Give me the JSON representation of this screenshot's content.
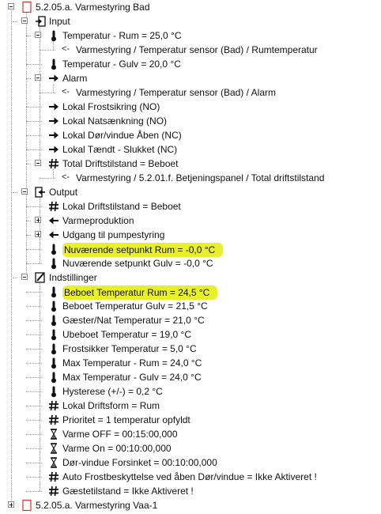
{
  "tree": {
    "rows": [
      {
        "depth": 0,
        "expander": "minus",
        "icon": "document-red-icon",
        "name": "root-node",
        "label": "5.2.05.a. Varmestyring Bad"
      },
      {
        "depth": 1,
        "expander": "minus",
        "icon": "input-icon",
        "name": "input-group",
        "label": "Input"
      },
      {
        "depth": 2,
        "expander": "minus",
        "icon": "thermometer-icon",
        "name": "temp-rum",
        "label": "Temperatur - Rum = 25,0 °C"
      },
      {
        "depth": 3,
        "expander": "none",
        "icon": "reference-arrow-icon",
        "name": "temp-rum-ref",
        "label": "Varmestyring / Temperatur sensor (Bad)  / Rumtemperatur"
      },
      {
        "depth": 2,
        "expander": "none",
        "icon": "thermometer-icon",
        "name": "temp-gulv",
        "label": "Temperatur - Gulv = 20,0 °C"
      },
      {
        "depth": 2,
        "expander": "minus",
        "icon": "arrow-right-icon",
        "name": "alarm",
        "label": "Alarm"
      },
      {
        "depth": 3,
        "expander": "none",
        "icon": "reference-arrow-icon",
        "name": "alarm-ref",
        "label": "Varmestyring / Temperatur sensor (Bad)  / Alarm"
      },
      {
        "depth": 2,
        "expander": "none",
        "icon": "arrow-right-icon",
        "name": "lokal-frostsikring",
        "label": "Lokal Frostsikring (NO)"
      },
      {
        "depth": 2,
        "expander": "none",
        "icon": "arrow-right-icon",
        "name": "lokal-natsaenkning",
        "label": "Lokal Natsænkning (NO)"
      },
      {
        "depth": 2,
        "expander": "none",
        "icon": "arrow-right-icon",
        "name": "lokal-dor-vindue",
        "label": "Lokal Dør/vindue Åben (NC)"
      },
      {
        "depth": 2,
        "expander": "none",
        "icon": "arrow-right-icon",
        "name": "lokal-taendt-slukket",
        "label": "Lokal Tændt - Slukket (NC)"
      },
      {
        "depth": 2,
        "expander": "minus",
        "icon": "hash-icon",
        "name": "total-driftstilstand",
        "label": "Total Driftstilstand = Beboet"
      },
      {
        "depth": 3,
        "expander": "none",
        "icon": "reference-arrow-icon",
        "name": "total-driftstilstand-ref",
        "label": "Varmestyring / 5.2.01.f. Betjeningspanel / Total driftstilstand"
      },
      {
        "depth": 1,
        "expander": "minus",
        "icon": "output-icon",
        "name": "output-group",
        "label": "Output"
      },
      {
        "depth": 2,
        "expander": "none",
        "icon": "hash-icon",
        "name": "lokal-driftstilstand",
        "label": "Lokal Driftstilstand = Beboet"
      },
      {
        "depth": 2,
        "expander": "plus",
        "icon": "arrow-left-icon",
        "name": "varmeproduktion",
        "label": "Varmeproduktion"
      },
      {
        "depth": 2,
        "expander": "plus",
        "icon": "arrow-left-icon",
        "name": "udgang-pumpestyring",
        "label": "Udgang til pumpestyring"
      },
      {
        "depth": 2,
        "expander": "none",
        "icon": "thermometer-icon",
        "name": "setpunkt-rum",
        "label": "Nuværende setpunkt Rum = -0,0 °C",
        "highlight": true
      },
      {
        "depth": 2,
        "expander": "none",
        "icon": "thermometer-icon",
        "name": "setpunkt-gulv",
        "label": "Nuværende setpunkt Gulv = -0,0 °C"
      },
      {
        "depth": 1,
        "expander": "minus",
        "icon": "edit-icon",
        "name": "indstillinger-group",
        "label": "Indstillinger"
      },
      {
        "depth": 2,
        "expander": "none",
        "icon": "thermometer-icon",
        "name": "beboet-temp-rum",
        "label": "Beboet Temperatur Rum = 24,5 °C",
        "highlight": true
      },
      {
        "depth": 2,
        "expander": "none",
        "icon": "thermometer-icon",
        "name": "beboet-temp-gulv",
        "label": "Beboet Temperatur Gulv = 21,5 °C"
      },
      {
        "depth": 2,
        "expander": "none",
        "icon": "thermometer-icon",
        "name": "gaester-nat-temp",
        "label": "Gæster/Nat Temperatur  = 21,0 °C"
      },
      {
        "depth": 2,
        "expander": "none",
        "icon": "thermometer-icon",
        "name": "ubeboet-temp",
        "label": "Ubeboet Temperatur  = 19,0 °C"
      },
      {
        "depth": 2,
        "expander": "none",
        "icon": "thermometer-icon",
        "name": "frostsikker-temp",
        "label": "Frostsikker Temperatur  = 5,0 °C"
      },
      {
        "depth": 2,
        "expander": "none",
        "icon": "thermometer-icon",
        "name": "max-temp-rum",
        "label": "Max Temperatur - Rum = 24,0 °C"
      },
      {
        "depth": 2,
        "expander": "none",
        "icon": "thermometer-icon",
        "name": "max-temp-gulv",
        "label": "Max Temperatur - Gulv = 24,0 °C"
      },
      {
        "depth": 2,
        "expander": "none",
        "icon": "thermometer-icon",
        "name": "hysterese",
        "label": "Hysterese (+/-) = 0,2 °C"
      },
      {
        "depth": 2,
        "expander": "none",
        "icon": "hash-icon",
        "name": "lokal-driftsform",
        "label": "Lokal Driftsform = Rum"
      },
      {
        "depth": 2,
        "expander": "none",
        "icon": "hash-icon",
        "name": "prioritet",
        "label": "Prioritet = 1 temperatur opfyldt"
      },
      {
        "depth": 2,
        "expander": "none",
        "icon": "hourglass-icon",
        "name": "varme-off",
        "label": "Varme OFF = 00:15:00,000"
      },
      {
        "depth": 2,
        "expander": "none",
        "icon": "hourglass-icon",
        "name": "varme-on",
        "label": "Varme On = 00:10:00,000"
      },
      {
        "depth": 2,
        "expander": "none",
        "icon": "hourglass-icon",
        "name": "dor-vindue-forsinket",
        "label": "Dør-vindue Forsinket = 00:10:00,000"
      },
      {
        "depth": 2,
        "expander": "none",
        "icon": "hash-icon",
        "name": "auto-frostbeskyttelse",
        "label": "Auto Frostbeskyttelse ved åben Dør/vindue = Ikke Aktiveret !"
      },
      {
        "depth": 2,
        "expander": "none",
        "icon": "hash-icon",
        "name": "gaestetilstand",
        "label": "Gæstetilstand = Ikke Aktiveret !"
      },
      {
        "depth": 0,
        "expander": "plus",
        "icon": "document-red-icon",
        "name": "next-root-node",
        "label": "5.2.05.a. Varmestyring Vaa-1"
      }
    ]
  }
}
